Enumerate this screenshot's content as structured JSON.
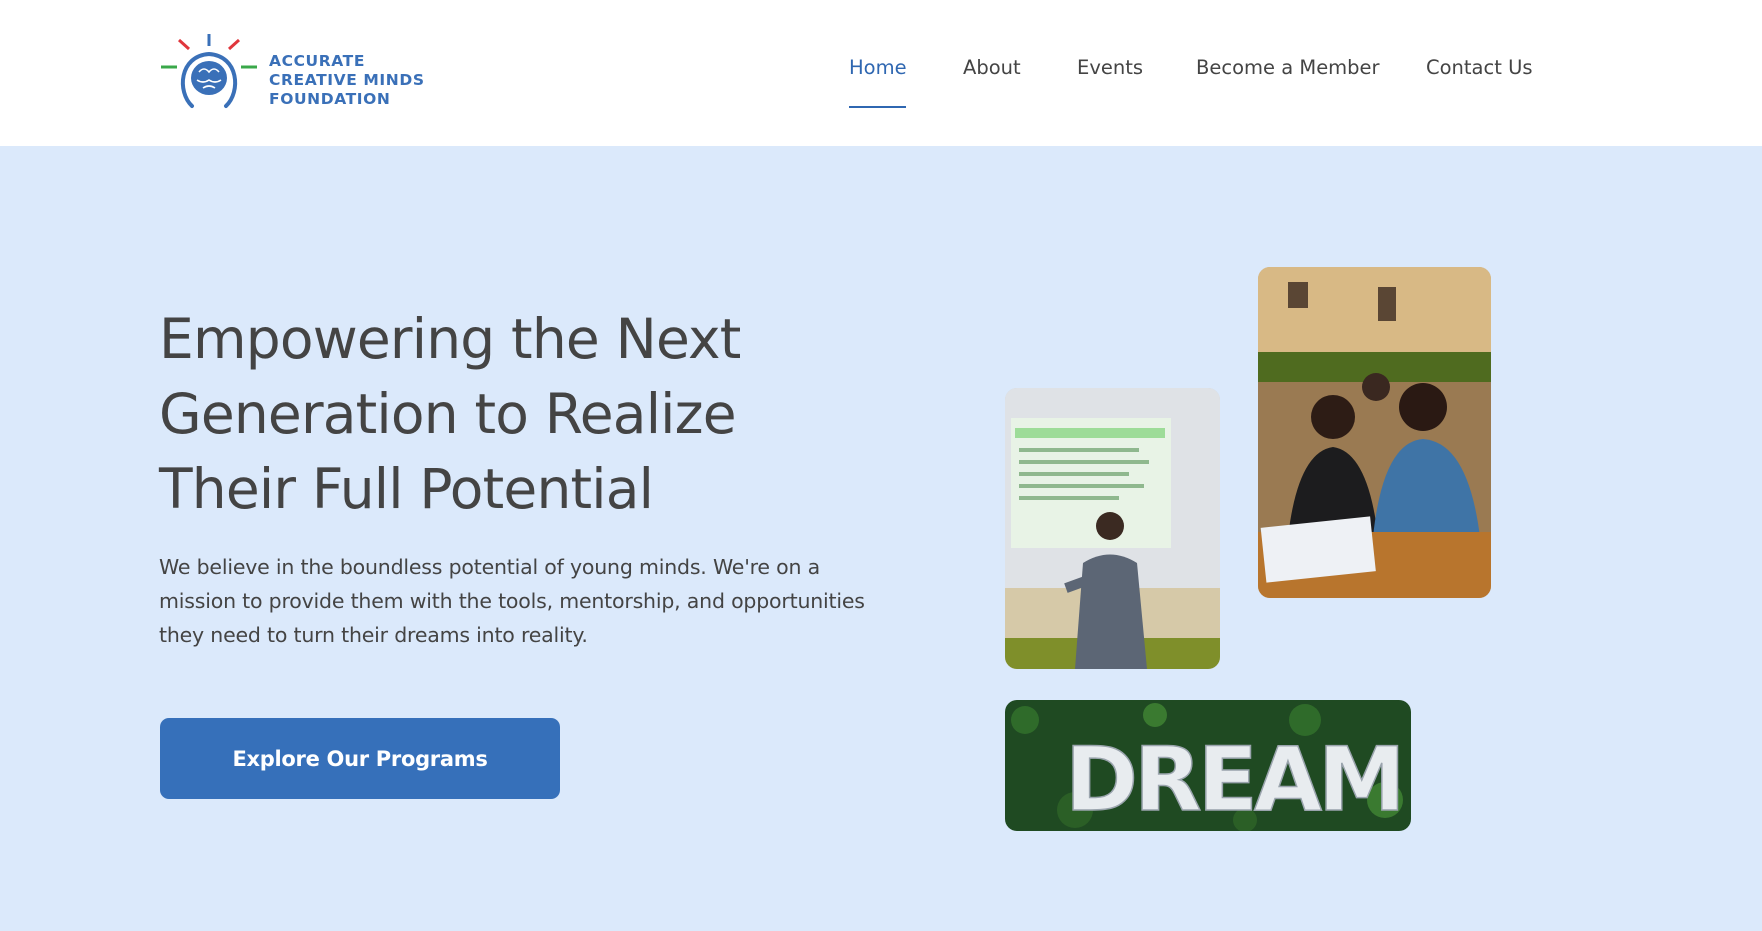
{
  "brand": {
    "name_lines": [
      "ACCURATE",
      "CREATIVE MINDS",
      "FOUNDATION"
    ],
    "logo_icon": "brain-lightbulb-icon",
    "color": "#3a70b8"
  },
  "nav": {
    "items": [
      {
        "label": "Home",
        "active": true
      },
      {
        "label": "About",
        "active": false
      },
      {
        "label": "Events",
        "active": false
      },
      {
        "label": "Become a Member",
        "active": false
      },
      {
        "label": "Contact Us",
        "active": false
      }
    ],
    "active_color": "#2f67b1"
  },
  "hero": {
    "title_lines": [
      "Empowering the Next",
      "Generation to Realize",
      "Their Full Potential"
    ],
    "description_lines": [
      "We believe in the boundless potential of young minds. We're on a",
      "mission to provide them with the tools, mentorship, and opportunities",
      "they need to turn their dreams into reality."
    ],
    "cta_label": "Explore Our Programs",
    "background": "#dbe9fb",
    "cta_color": "#3670ba"
  },
  "images": {
    "speaker": "speaker-presenting-photo",
    "students": "students-seated-photo",
    "dream": "dream-letters-photo",
    "dream_word": "DREAM"
  }
}
